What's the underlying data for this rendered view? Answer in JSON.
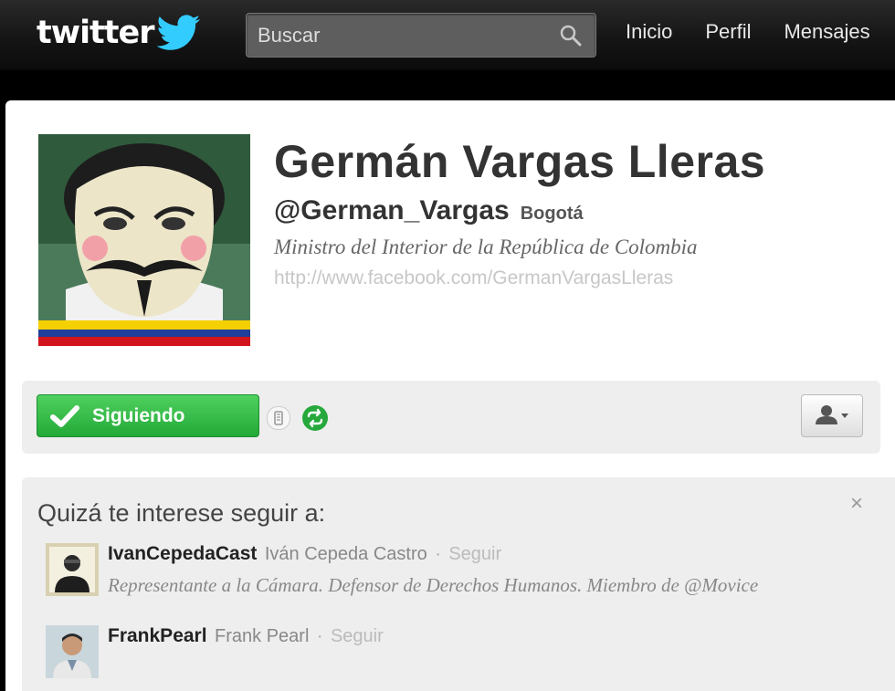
{
  "topbar": {
    "logo_text": "twitter",
    "search": {
      "placeholder": "Buscar"
    },
    "nav": [
      {
        "label": "Inicio"
      },
      {
        "label": "Perfil"
      },
      {
        "label": "Mensajes"
      }
    ]
  },
  "profile": {
    "name": "Germán Vargas Lleras",
    "handle": "@German_Vargas",
    "location": "Bogotá",
    "bio": "Ministro del Interior de la República de Colombia",
    "url": "http://www.facebook.com/GermanVargasLleras"
  },
  "actions": {
    "follow_label": "Siguiendo",
    "icons": [
      "check-icon",
      "device-icon",
      "retweet-icon",
      "user-menu-icon"
    ]
  },
  "suggestions": {
    "title": "Quizá te interese seguir a:",
    "close_label": "×",
    "items": [
      {
        "username": "IvanCepedaCast",
        "full_name": "Iván Cepeda Castro",
        "separator": "·",
        "follow_label": "Seguir",
        "description": "Representante a la Cámara. Defensor de Derechos Humanos. Miembro de @Movice"
      },
      {
        "username": "FrankPearl",
        "full_name": "Frank Pearl",
        "separator": "·",
        "follow_label": "Seguir",
        "description": ""
      }
    ]
  },
  "colors": {
    "topbar": "#1a1a1a",
    "follow_green": "#2bb33f",
    "bird_blue": "#33ccff"
  }
}
